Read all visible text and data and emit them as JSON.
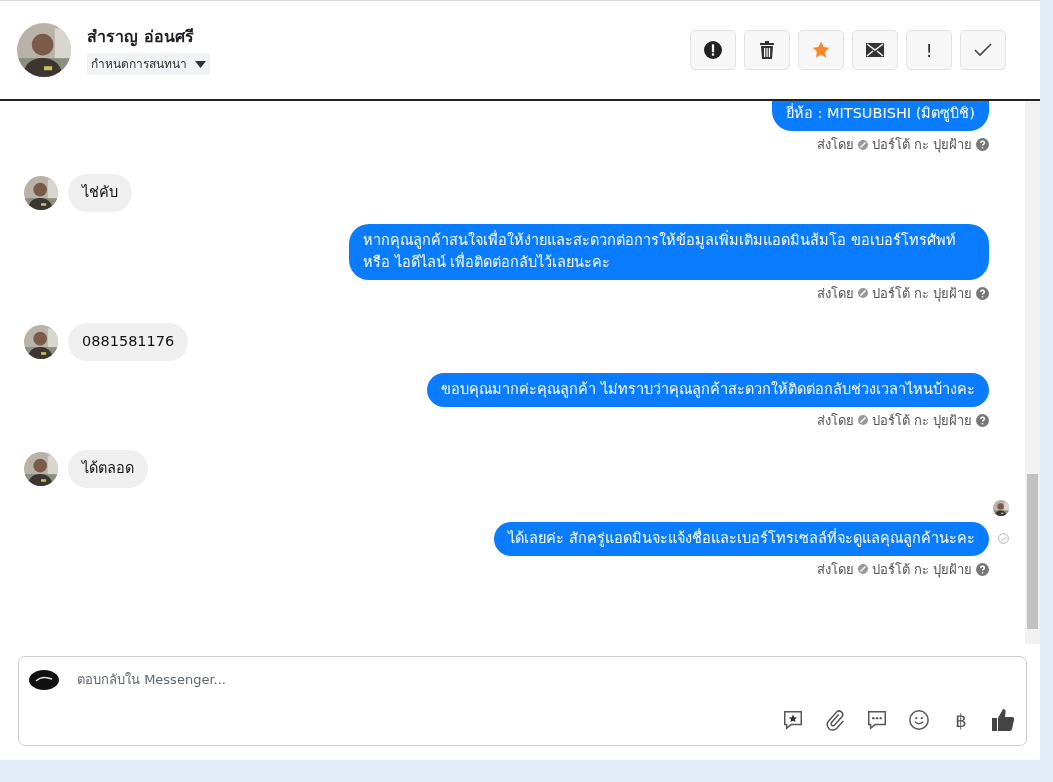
{
  "header": {
    "name": "สำราญ อ่อนศรี",
    "assign_label": "กำหนดการสนทนา",
    "actions": [
      {
        "kind": "alert"
      },
      {
        "kind": "trash"
      },
      {
        "kind": "star"
      },
      {
        "kind": "mail"
      },
      {
        "kind": "exclaim",
        "label": "!"
      },
      {
        "kind": "check"
      }
    ]
  },
  "messages": [
    {
      "kind": "outgoing",
      "text": "ยี่ห้อ : MITSUBISHI (มิตซูบิชิ)",
      "cut_top": true,
      "sent_by": "ส่งโดย",
      "sender": "ปอร์โต้ กะ ปุยฝ้าย",
      "seen": false
    },
    {
      "kind": "incoming",
      "text": "ไช่คับ"
    },
    {
      "kind": "outgoing",
      "text": "หากคุณลูกค้าสนใจเพื่อให้ง่ายและสะดวกต่อการให้ข้อมูลเพิ่มเติมแอดมินส้มโอ ขอเบอร์โทรศัพท์ หรือ ไอดีไลน์ เพื่อติดต่อกลับไว้เลยนะคะ",
      "cut_top": false,
      "sent_by": "ส่งโดย",
      "sender": "ปอร์โต้ กะ ปุยฝ้าย",
      "seen": false
    },
    {
      "kind": "incoming",
      "text": "0881581176"
    },
    {
      "kind": "outgoing",
      "text": "ขอบคุณมากค่ะคุณลูกค้า ไม่ทราบว่าคุณลูกค้าสะดวกให้ติดต่อกลับช่วงเวลาไหนบ้างคะ",
      "cut_top": false,
      "sent_by": "ส่งโดย",
      "sender": "ปอร์โต้ กะ ปุยฝ้าย",
      "seen": false
    },
    {
      "kind": "incoming",
      "text": "ได้ตลอด"
    },
    {
      "kind": "outgoing",
      "text": "ได้เลยค่ะ สักครู่แอดมินจะแจ้งชื่อและเบอร์โทรเซลล์ที่จะดูแลคุณลูกค้านะคะ",
      "cut_top": false,
      "sent_by": "ส่งโดย",
      "sender": "ปอร์โต้ กะ ปุยฝ้าย",
      "seen": true
    }
  ],
  "composer": {
    "placeholder": "ตอบกลับใน Messenger...",
    "tools": [
      {
        "kind": "saved-reply"
      },
      {
        "kind": "attach"
      },
      {
        "kind": "chat"
      },
      {
        "kind": "emoji"
      },
      {
        "kind": "baht",
        "label": "฿"
      },
      {
        "kind": "like"
      }
    ]
  }
}
